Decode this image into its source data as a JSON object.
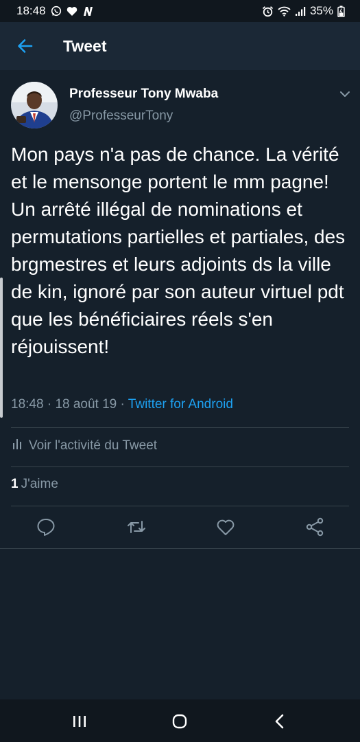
{
  "status_bar": {
    "time": "18:48",
    "battery": "35%",
    "left_icons": [
      "whatsapp-icon",
      "heart-icon",
      "n-app-icon"
    ],
    "right_icons": [
      "alarm-icon",
      "wifi-icon",
      "signal-icon",
      "battery-icon"
    ]
  },
  "app_bar": {
    "title": "Tweet",
    "back_icon": "arrow-left-icon",
    "accent_color": "#1da1f2"
  },
  "tweet": {
    "author_name": "Professeur Tony Mwaba",
    "author_handle": "@ProfesseurTony",
    "text": "Mon pays n'a pas de chance. La vérité et le mensonge portent le mm pagne! Un arrêté illégal de nominations et permutations partielles et partiales, des brgmestres et leurs adjoints ds la ville de kin, ignoré par son auteur virtuel pdt que les bénéficiaires réels s'en réjouissent!",
    "time": "18:48",
    "sep": " · ",
    "date": "18 août 19",
    "client": "Twitter for Android",
    "activity_label": "Voir l'activité du Tweet",
    "likes_count": "1",
    "likes_label": "J'aime"
  },
  "actions": [
    "reply-icon",
    "retweet-icon",
    "like-icon",
    "share-icon"
  ],
  "nav": [
    "recent-apps-icon",
    "home-icon",
    "back-icon"
  ],
  "colors": {
    "background": "#15202b",
    "header": "#1b2836",
    "status_bar": "#10171e",
    "secondary_text": "#8899a6",
    "divider": "#38444d",
    "link": "#1da1f2"
  }
}
